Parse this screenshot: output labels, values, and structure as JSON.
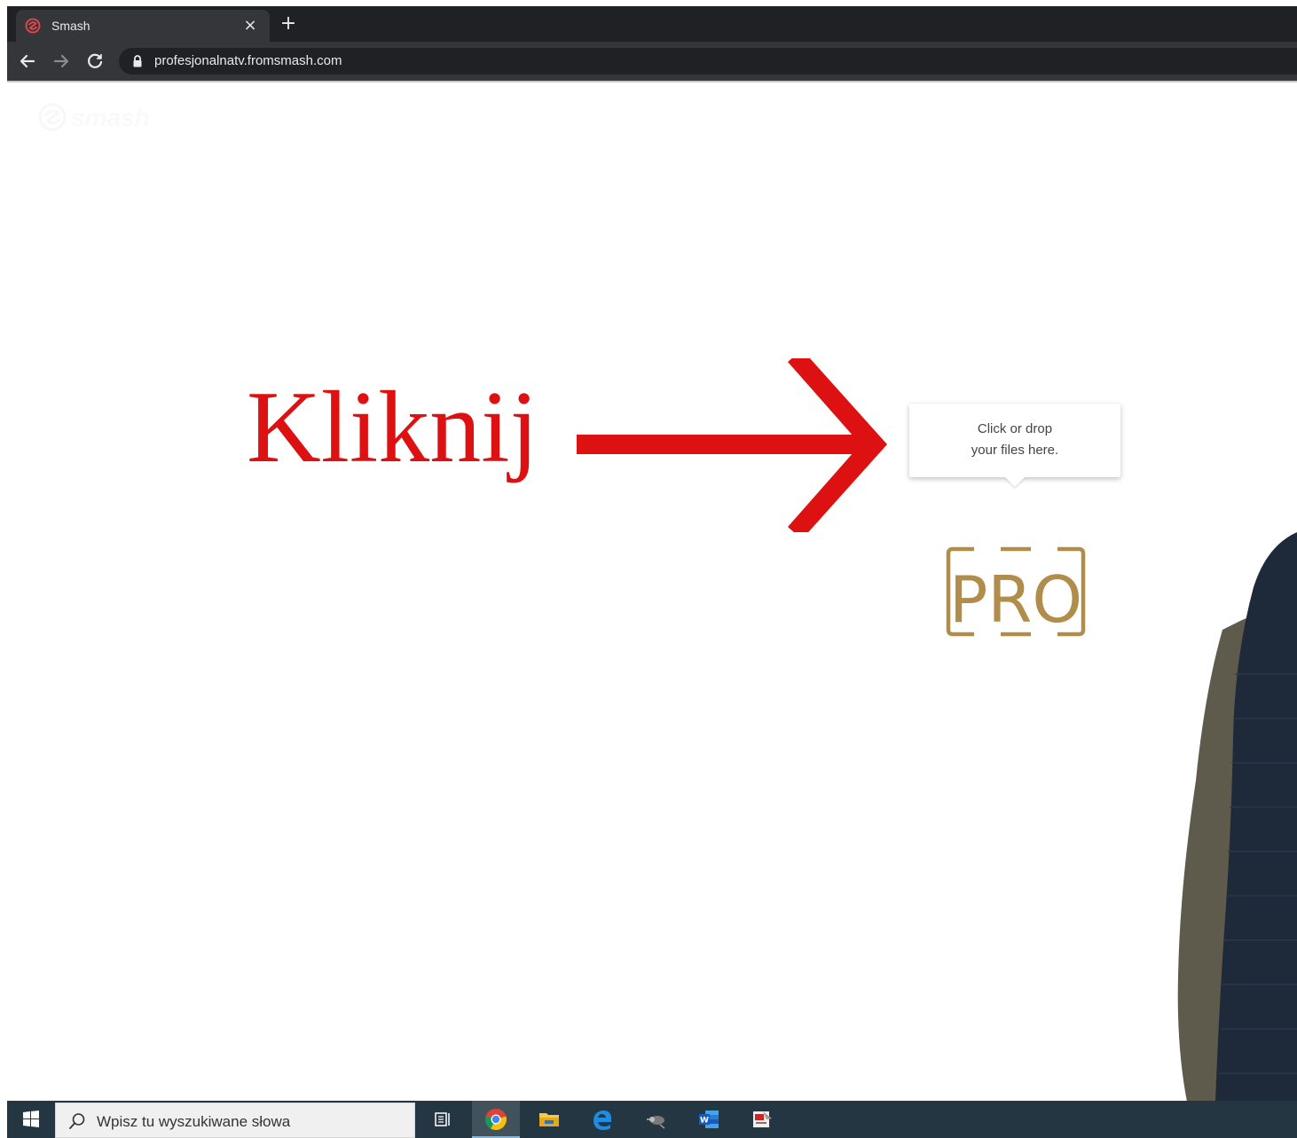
{
  "browser": {
    "tab": {
      "title": "Smash",
      "favicon": "smash-favicon-icon",
      "close_glyph": "×"
    },
    "new_tab_glyph": "+",
    "address_bar": {
      "url": "profesjonalnatv.fromsmash.com",
      "secure_icon": "lock-icon"
    },
    "nav": {
      "back_icon": "arrow-left-icon",
      "forward_icon": "arrow-right-icon",
      "reload_icon": "reload-icon"
    }
  },
  "page": {
    "site_logo_text": "smash",
    "annotation": {
      "text": "Kliknij",
      "color": "#dd1111"
    },
    "dropzone": {
      "line1": "Click or drop",
      "line2": "your files here."
    },
    "brand_logo_text": "PRO",
    "brand_color": "#b08d4a"
  },
  "taskbar": {
    "search_placeholder": "Wpisz tu wyszukiwane słowa",
    "pinned": [
      "task-view-icon",
      "chrome-icon",
      "file-explorer-icon",
      "edge-icon",
      "app-icon",
      "word-icon",
      "app-icon-2"
    ],
    "active_app": "chrome-icon"
  }
}
